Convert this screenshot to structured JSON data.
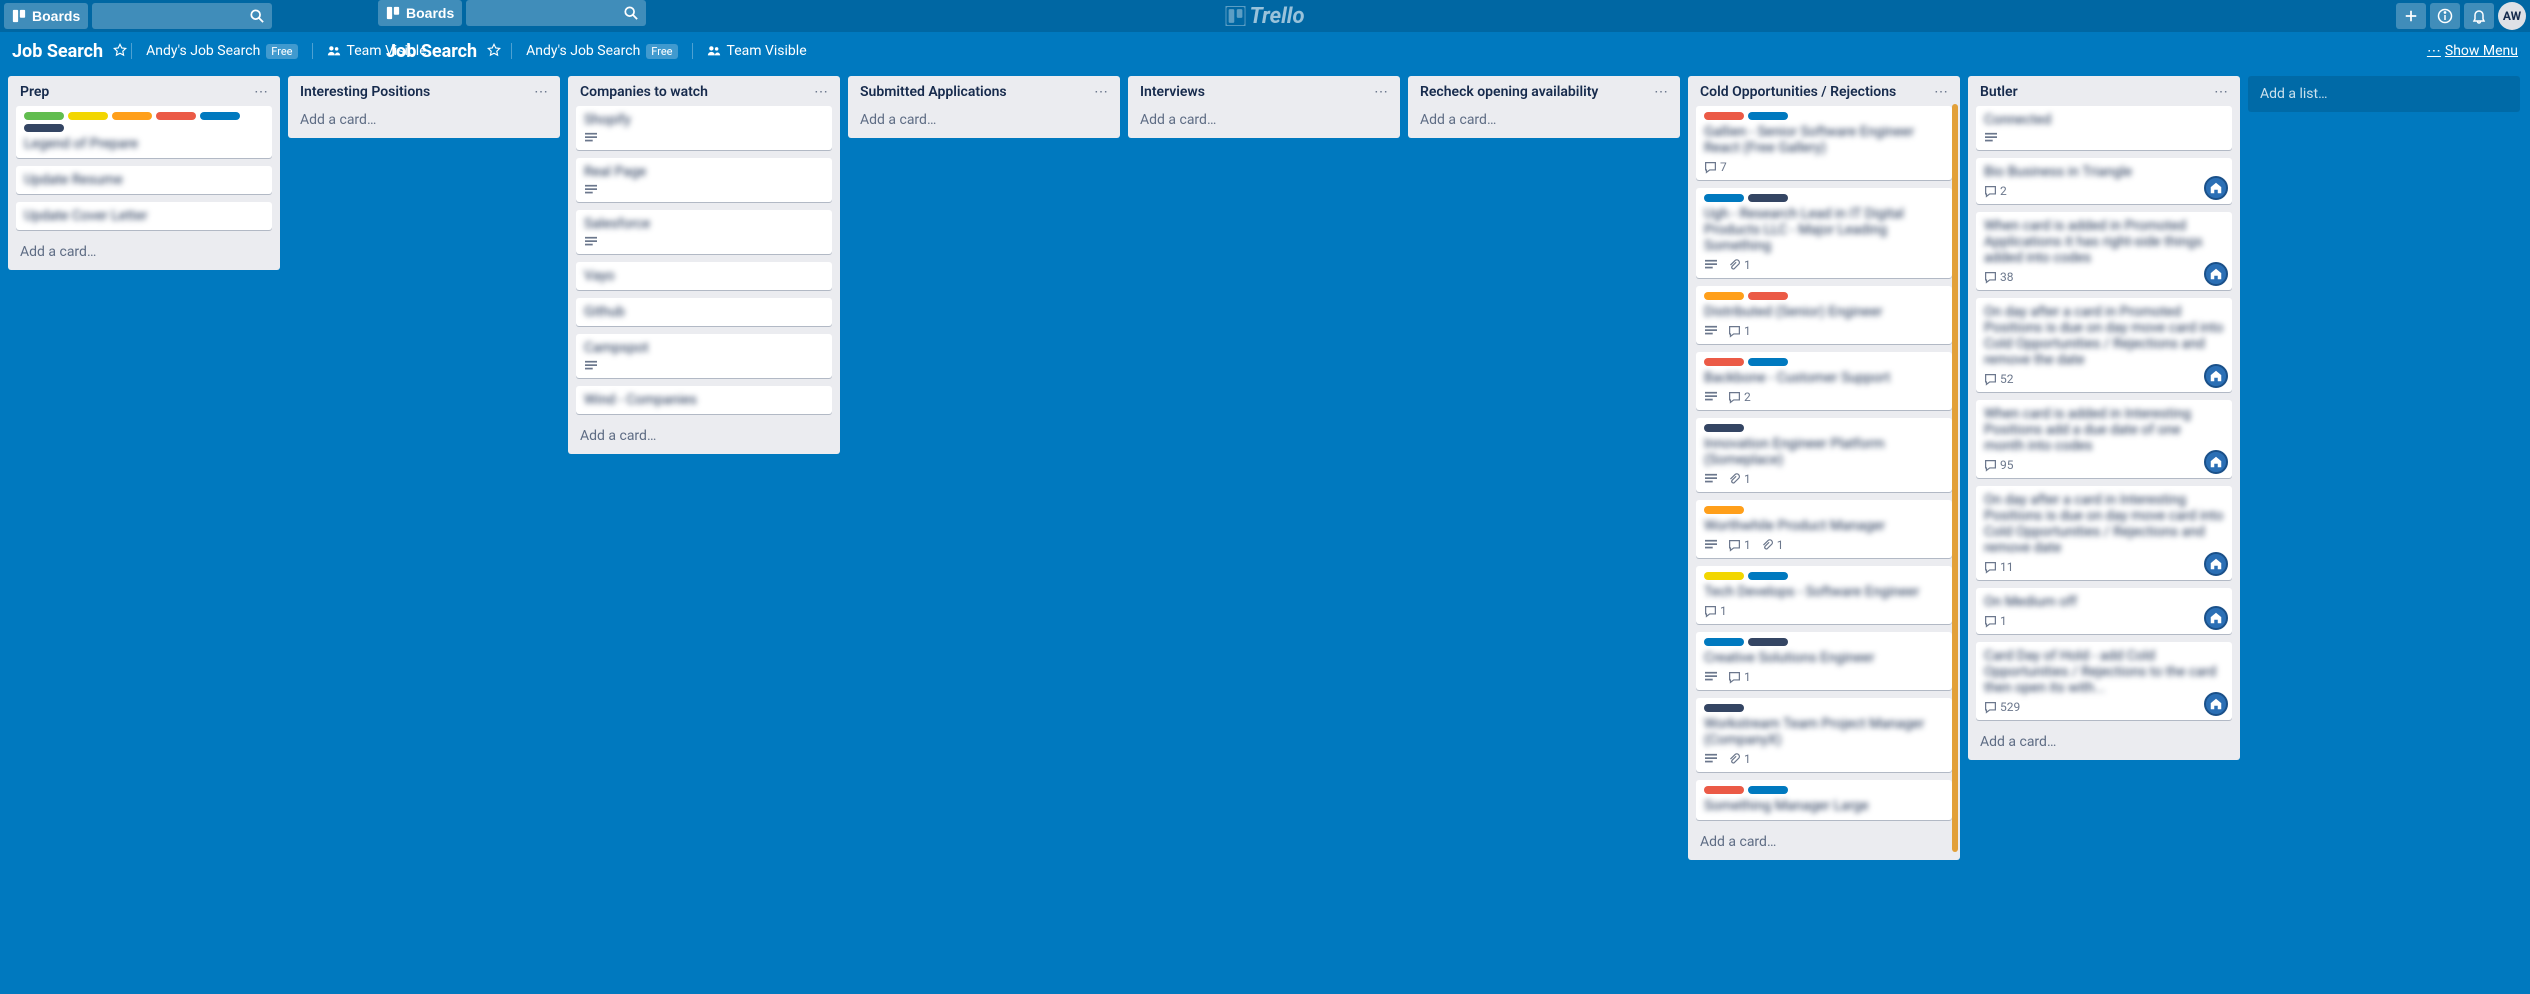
{
  "header": {
    "boards_label": "Boards",
    "logo": "Trello",
    "avatar": "AW"
  },
  "board": {
    "name": "Job Search",
    "team": "Andy's Job Search",
    "team_badge": "Free",
    "visibility": "Team Visible",
    "show_menu": "Show Menu"
  },
  "add_list": "Add a list…",
  "add_card": "Add a card…",
  "lists": [
    {
      "title": "Prep",
      "cards": [
        {
          "labels": [
            "green",
            "yellow",
            "orange",
            "red",
            "blue",
            "black"
          ],
          "title": "Legend of Prepare"
        },
        {
          "title": "Update Resume"
        },
        {
          "title": "Update Cover Letter"
        }
      ]
    },
    {
      "title": "Interesting Positions",
      "cards": []
    },
    {
      "title": "Companies to watch",
      "cards": [
        {
          "title": "Shopify",
          "badges": {
            "desc": true
          }
        },
        {
          "title": "Real Page",
          "badges": {
            "desc": true
          }
        },
        {
          "title": "Salesforce",
          "badges": {
            "desc": true
          }
        },
        {
          "title": "Vayo"
        },
        {
          "title": "Github"
        },
        {
          "title": "Campspot",
          "badges": {
            "desc": true
          }
        },
        {
          "title": "Wind - Companies"
        }
      ]
    },
    {
      "title": "Submitted Applications",
      "cards": []
    },
    {
      "title": "Interviews",
      "cards": []
    },
    {
      "title": "Recheck opening availability",
      "cards": []
    },
    {
      "title": "Cold Opportunities / Rejections",
      "cold": true,
      "cards": [
        {
          "labels": [
            "red",
            "blue"
          ],
          "title": "Gallien - Senior Software Engineer React (Free Gallery)",
          "badges": {
            "comments": 7
          }
        },
        {
          "labels": [
            "blue",
            "black"
          ],
          "title": "Ugh - Research Lead in IT Digital Products LLC - Major Leading Something",
          "badges": {
            "desc": true,
            "attach": 1
          }
        },
        {
          "labels": [
            "orange",
            "red"
          ],
          "title": "Distributed (Senior) Engineer",
          "badges": {
            "desc": true,
            "comments": 1
          }
        },
        {
          "labels": [
            "red",
            "blue"
          ],
          "title": "Backbone - Customer Support",
          "badges": {
            "desc": true,
            "comments": 2
          }
        },
        {
          "labels": [
            "black"
          ],
          "title": "Innovation Engineer Platform (Someplace)",
          "badges": {
            "desc": true,
            "attach": 1
          }
        },
        {
          "labels": [
            "orange"
          ],
          "title": "Worthwhile Product Manager",
          "badges": {
            "desc": true,
            "comments": 1,
            "attach": 1
          }
        },
        {
          "labels": [
            "yellow",
            "blue"
          ],
          "title": "Tech Develops - Software Engineer",
          "badges": {
            "comments": 1
          }
        },
        {
          "labels": [
            "blue",
            "black"
          ],
          "title": "Creative Solutions Engineer",
          "badges": {
            "desc": true,
            "comments": 1
          }
        },
        {
          "labels": [
            "black"
          ],
          "title": "Workstream Team Project Manager (CompanyX)",
          "badges": {
            "desc": true,
            "attach": 1
          }
        },
        {
          "labels": [
            "red",
            "blue"
          ],
          "title": "Something Manager Large"
        }
      ]
    },
    {
      "title": "Butler",
      "cards": [
        {
          "title": "Connected",
          "badges": {
            "desc": true
          }
        },
        {
          "title": "Bio Business in Triangle",
          "badges": {
            "comments": 2
          },
          "member": true
        },
        {
          "title": "When card is added in Promoted Applications it has right-side things added into codes",
          "badges": {
            "comments": 38
          },
          "member": true
        },
        {
          "title": "On day after a card in Promoted Positions is due on day move card into Cold Opportunities / Rejections and remove the date",
          "badges": {
            "comments": 52
          },
          "member": true
        },
        {
          "title": "When card is added in Interesting Positions add a due date of one month into codes",
          "badges": {
            "comments": 95
          },
          "member": true
        },
        {
          "title": "On day after a card in Interesting Positions is due on day move card into Cold Opportunities / Rejections and remove date",
          "badges": {
            "comments": 11
          },
          "member": true
        },
        {
          "title": "On Medium off",
          "badges": {
            "comments": 1
          },
          "member": true
        },
        {
          "title": "Card Day of Hold - add Cold Opportunities / Rejections to the card then open its with...",
          "badges": {
            "comments": 529
          },
          "member": true
        }
      ]
    }
  ]
}
